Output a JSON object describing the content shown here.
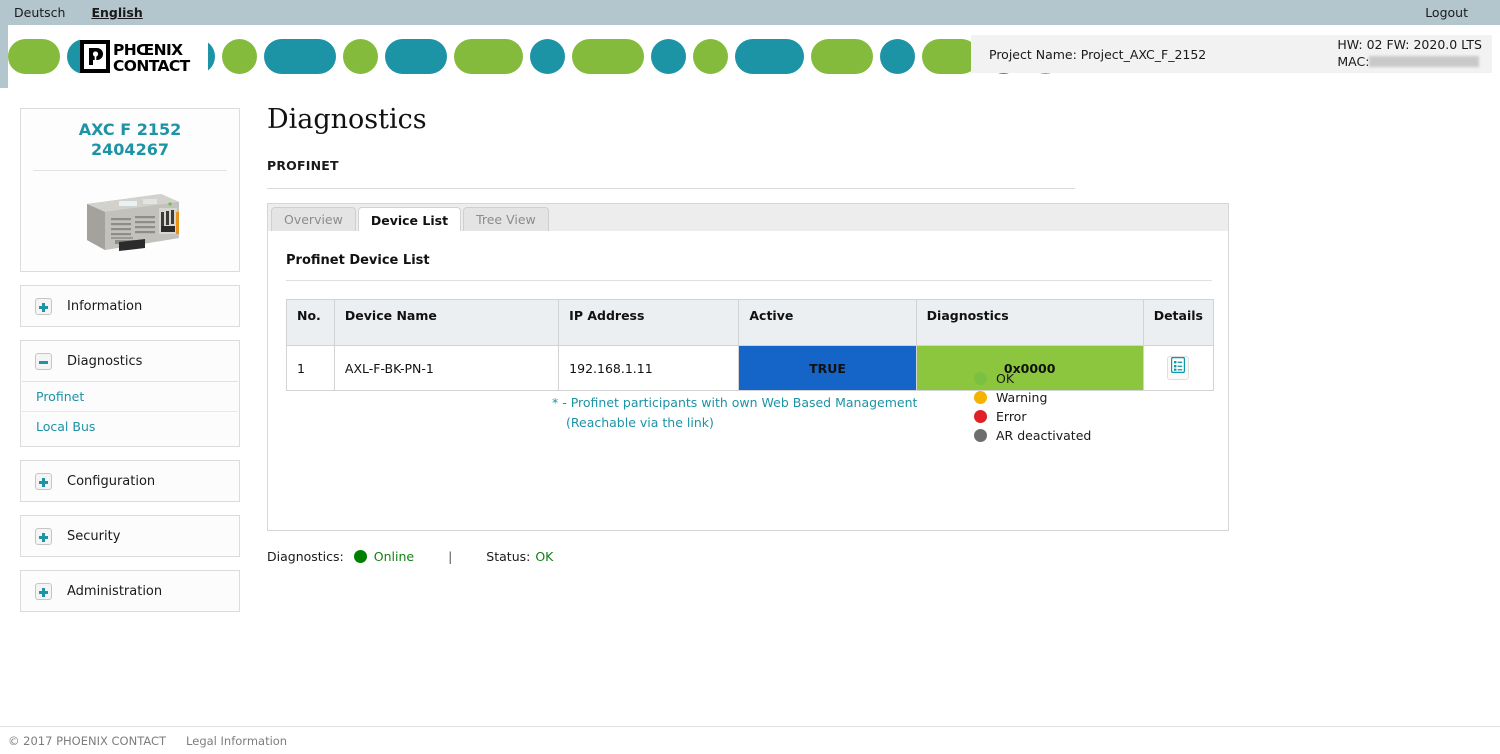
{
  "langbar": {
    "languages": [
      {
        "label": "Deutsch",
        "active": false
      },
      {
        "label": "English",
        "active": true
      }
    ],
    "logout": "Logout"
  },
  "banner": {
    "logo_alt": "PHOENIX CONTACT",
    "logo_line1": "PHŒNIX",
    "logo_line2": "CONTACT",
    "project_name": "Project Name: Project_AXC_F_2152",
    "hw_fw": "HW: 02 FW: 2020.0 LTS",
    "mac_label": "MAC:",
    "mac_value": "",
    "pills": [
      {
        "color": "green",
        "width": 52
      },
      {
        "color": "teal",
        "width": 35
      },
      {
        "color": "green",
        "width": 0
      },
      {
        "color": "green",
        "width": 64
      },
      {
        "color": "teal",
        "width": 35
      },
      {
        "color": "green",
        "width": 35
      },
      {
        "color": "teal",
        "width": 72
      },
      {
        "color": "green",
        "width": 35
      },
      {
        "color": "teal",
        "width": 62
      },
      {
        "color": "green",
        "width": 69
      },
      {
        "color": "teal",
        "width": 35
      },
      {
        "color": "green",
        "width": 72
      },
      {
        "color": "teal",
        "width": 35
      },
      {
        "color": "green",
        "width": 35
      },
      {
        "color": "teal",
        "width": 69
      },
      {
        "color": "green",
        "width": 62
      },
      {
        "color": "teal",
        "width": 35
      },
      {
        "color": "green",
        "width": 57
      },
      {
        "color": "teal",
        "width": 35
      },
      {
        "color": "green",
        "width": 35
      }
    ],
    "colors": {
      "green": "#85bb3c",
      "teal": "#1d93a6"
    }
  },
  "sidebar": {
    "device": {
      "name": "AXC F 2152",
      "article_no": "2404267"
    },
    "sections": [
      {
        "label": "Information",
        "state": "collapsed",
        "icon": "plus-icon",
        "links": []
      },
      {
        "label": "Diagnostics",
        "state": "expanded",
        "icon": "minus-icon",
        "links": [
          {
            "label": "Profinet",
            "active": true
          },
          {
            "label": "Local Bus",
            "active": false
          }
        ]
      },
      {
        "label": "Configuration",
        "state": "collapsed",
        "icon": "plus-icon",
        "links": []
      },
      {
        "label": "Security",
        "state": "collapsed",
        "icon": "plus-icon",
        "links": []
      },
      {
        "label": "Administration",
        "state": "collapsed",
        "icon": "plus-icon",
        "links": []
      }
    ]
  },
  "main": {
    "page_title": "Diagnostics",
    "subtitle": "PROFINET",
    "tabs": [
      {
        "label": "Overview",
        "active": false
      },
      {
        "label": "Device List",
        "active": true
      },
      {
        "label": "Tree View",
        "active": false
      }
    ],
    "list_title": "Profinet Device List",
    "table": {
      "columns": [
        "No.",
        "Device Name",
        "IP Address",
        "Active",
        "Diagnostics",
        "Details"
      ],
      "rows": [
        {
          "no": "1",
          "device_name": "AXL-F-BK-PN-1",
          "ip_address": "192.168.1.11",
          "active": "TRUE",
          "diagnostics": "0x0000",
          "details_icon": "details-list-icon"
        }
      ]
    },
    "footnote": {
      "line1": "* - Profinet participants with own Web Based Management",
      "line2": "(Reachable via the link)"
    },
    "legend": [
      {
        "label": "OK",
        "color": "#7ac143"
      },
      {
        "label": "Warning",
        "color": "#f5b301"
      },
      {
        "label": "Error",
        "color": "#e02027"
      },
      {
        "label": "AR deactivated",
        "color": "#6e6e6e"
      }
    ],
    "status": {
      "diag_label": "Diagnostics:",
      "diag_value": "Online",
      "separator": "|",
      "status_label": "Status:",
      "status_value": "OK"
    }
  },
  "footer": {
    "copyright": "© 2017 PHOENIX CONTACT",
    "legal": "Legal Information"
  },
  "colors": {
    "brand_teal": "#1d93a6",
    "brand_green": "#85bb3c",
    "active_blue": "#1565c8",
    "diag_green": "#8cc63e",
    "langbar_bg": "#b3c6ce"
  }
}
